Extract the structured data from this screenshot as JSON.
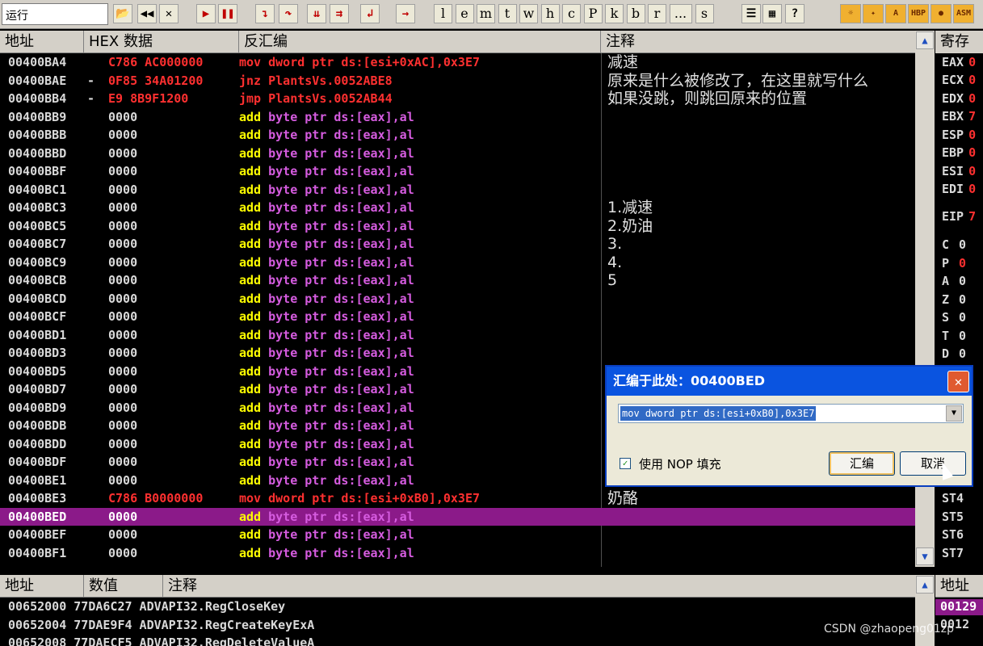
{
  "toolbar": {
    "status": "运行",
    "buttons": [
      {
        "id": "open",
        "label": "📂"
      },
      {
        "id": "restart",
        "label": "◀◀"
      },
      {
        "id": "close",
        "label": "✕"
      },
      {
        "id": "run",
        "label": "▶"
      },
      {
        "id": "pause",
        "label": "❚❚"
      },
      {
        "id": "step-into",
        "label": "↴"
      },
      {
        "id": "step-over",
        "label": "↷"
      },
      {
        "id": "trace-into",
        "label": "⇊"
      },
      {
        "id": "trace-over",
        "label": "⇉"
      },
      {
        "id": "till-return",
        "label": "↲"
      },
      {
        "id": "goto",
        "label": "→"
      }
    ],
    "letters": [
      "l",
      "e",
      "m",
      "t",
      "w",
      "h",
      "c",
      "P",
      "k",
      "b",
      "r",
      "...",
      "s"
    ],
    "right_buttons": [
      "☰",
      "▦",
      "?"
    ],
    "plugin_buttons": [
      "☼",
      "✦",
      "A",
      "HBP",
      "●",
      "ASM"
    ]
  },
  "disasm": {
    "headers": {
      "address": "地址",
      "hex": "HEX 数据",
      "disassembly": "反汇编",
      "comment": "注释"
    },
    "rows": [
      {
        "addr": "00400BA4",
        "mark": "",
        "hex": "C786 AC000000",
        "op": "mov",
        "args": "dword ptr ds:[esi+0xAC],0x3E7",
        "kind": "red",
        "cmt": "减速"
      },
      {
        "addr": "00400BAE",
        "mark": "-",
        "hex": "0F85 34A01200",
        "op": "jnz",
        "args": "PlantsVs.0052ABE8",
        "kind": "red",
        "cmt": "原来是什么被修改了，在这里就写什么"
      },
      {
        "addr": "00400BB4",
        "mark": "-",
        "hex": "E9 8B9F1200",
        "op": "jmp",
        "args": "PlantsVs.0052AB44",
        "kind": "red",
        "cmt": "如果没跳，则跳回原来的位置"
      },
      {
        "addr": "00400BB9",
        "mark": "",
        "hex": "0000",
        "op": "add",
        "args": "byte ptr ds:[eax],al",
        "kind": "add",
        "cmt": ""
      },
      {
        "addr": "00400BBB",
        "mark": "",
        "hex": "0000",
        "op": "add",
        "args": "byte ptr ds:[eax],al",
        "kind": "add",
        "cmt": ""
      },
      {
        "addr": "00400BBD",
        "mark": "",
        "hex": "0000",
        "op": "add",
        "args": "byte ptr ds:[eax],al",
        "kind": "add",
        "cmt": ""
      },
      {
        "addr": "00400BBF",
        "mark": "",
        "hex": "0000",
        "op": "add",
        "args": "byte ptr ds:[eax],al",
        "kind": "add",
        "cmt": ""
      },
      {
        "addr": "00400BC1",
        "mark": "",
        "hex": "0000",
        "op": "add",
        "args": "byte ptr ds:[eax],al",
        "kind": "add",
        "cmt": ""
      },
      {
        "addr": "00400BC3",
        "mark": "",
        "hex": "0000",
        "op": "add",
        "args": "byte ptr ds:[eax],al",
        "kind": "add",
        "cmt": "1.减速"
      },
      {
        "addr": "00400BC5",
        "mark": "",
        "hex": "0000",
        "op": "add",
        "args": "byte ptr ds:[eax],al",
        "kind": "add",
        "cmt": "2.奶油"
      },
      {
        "addr": "00400BC7",
        "mark": "",
        "hex": "0000",
        "op": "add",
        "args": "byte ptr ds:[eax],al",
        "kind": "add",
        "cmt": "3."
      },
      {
        "addr": "00400BC9",
        "mark": "",
        "hex": "0000",
        "op": "add",
        "args": "byte ptr ds:[eax],al",
        "kind": "add",
        "cmt": "4."
      },
      {
        "addr": "00400BCB",
        "mark": "",
        "hex": "0000",
        "op": "add",
        "args": "byte ptr ds:[eax],al",
        "kind": "add",
        "cmt": "5"
      },
      {
        "addr": "00400BCD",
        "mark": "",
        "hex": "0000",
        "op": "add",
        "args": "byte ptr ds:[eax],al",
        "kind": "add",
        "cmt": ""
      },
      {
        "addr": "00400BCF",
        "mark": "",
        "hex": "0000",
        "op": "add",
        "args": "byte ptr ds:[eax],al",
        "kind": "add",
        "cmt": ""
      },
      {
        "addr": "00400BD1",
        "mark": "",
        "hex": "0000",
        "op": "add",
        "args": "byte ptr ds:[eax],al",
        "kind": "add",
        "cmt": ""
      },
      {
        "addr": "00400BD3",
        "mark": "",
        "hex": "0000",
        "op": "add",
        "args": "byte ptr ds:[eax],al",
        "kind": "add",
        "cmt": ""
      },
      {
        "addr": "00400BD5",
        "mark": "",
        "hex": "0000",
        "op": "add",
        "args": "byte ptr ds:[eax],al",
        "kind": "add",
        "cmt": ""
      },
      {
        "addr": "00400BD7",
        "mark": "",
        "hex": "0000",
        "op": "add",
        "args": "byte ptr ds:[eax],al",
        "kind": "add",
        "cmt": ""
      },
      {
        "addr": "00400BD9",
        "mark": "",
        "hex": "0000",
        "op": "add",
        "args": "byte ptr ds:[eax],al",
        "kind": "add",
        "cmt": ""
      },
      {
        "addr": "00400BDB",
        "mark": "",
        "hex": "0000",
        "op": "add",
        "args": "byte ptr ds:[eax],al",
        "kind": "add",
        "cmt": ""
      },
      {
        "addr": "00400BDD",
        "mark": "",
        "hex": "0000",
        "op": "add",
        "args": "byte ptr ds:[eax],al",
        "kind": "add",
        "cmt": ""
      },
      {
        "addr": "00400BDF",
        "mark": "",
        "hex": "0000",
        "op": "add",
        "args": "byte ptr ds:[eax],al",
        "kind": "add",
        "cmt": ""
      },
      {
        "addr": "00400BE1",
        "mark": "",
        "hex": "0000",
        "op": "add",
        "args": "byte ptr ds:[eax],al",
        "kind": "add",
        "cmt": ""
      },
      {
        "addr": "00400BE3",
        "mark": "",
        "hex": "C786 B0000000",
        "op": "mov",
        "args": "dword ptr ds:[esi+0xB0],0x3E7",
        "kind": "red",
        "cmt": "奶酪"
      },
      {
        "addr": "00400BED",
        "mark": "",
        "hex": "0000",
        "op": "add",
        "args": "byte ptr ds:[eax],al",
        "kind": "add",
        "cmt": "",
        "selected": true
      },
      {
        "addr": "00400BEF",
        "mark": "",
        "hex": "0000",
        "op": "add",
        "args": "byte ptr ds:[eax],al",
        "kind": "add",
        "cmt": ""
      },
      {
        "addr": "00400BF1",
        "mark": "",
        "hex": "0000",
        "op": "add",
        "args": "byte ptr ds:[eax],al",
        "kind": "add",
        "cmt": ""
      }
    ]
  },
  "registers": {
    "header": "寄存器",
    "items": [
      {
        "name": "EAX",
        "val": "0"
      },
      {
        "name": "ECX",
        "val": "0"
      },
      {
        "name": "EDX",
        "val": "0"
      },
      {
        "name": "EBX",
        "val": "7"
      },
      {
        "name": "ESP",
        "val": "0"
      },
      {
        "name": "EBP",
        "val": "0"
      },
      {
        "name": "ESI",
        "val": "0"
      },
      {
        "name": "EDI",
        "val": "0"
      },
      {
        "name": "EIP",
        "val": "7"
      }
    ],
    "flags": [
      {
        "name": "C",
        "val": "0",
        "red": false
      },
      {
        "name": "P",
        "val": "0",
        "red": true
      },
      {
        "name": "A",
        "val": "0",
        "red": false
      },
      {
        "name": "Z",
        "val": "0",
        "red": false
      },
      {
        "name": "S",
        "val": "0",
        "red": false
      },
      {
        "name": "T",
        "val": "0",
        "red": false
      },
      {
        "name": "D",
        "val": "0",
        "red": false
      }
    ],
    "fpu": [
      "ST4",
      "ST5",
      "ST6",
      "ST7"
    ]
  },
  "dump": {
    "headers": {
      "address": "地址",
      "value": "数值",
      "comment": "注释"
    },
    "rows": [
      "00652000 77DA6C27 ADVAPI32.RegCloseKey",
      "00652004 77DAE9F4 ADVAPI32.RegCreateKeyExA",
      "00652008 77DAECF5 ADVAPI32.RegDeleteValueA"
    ]
  },
  "stack": {
    "header": "地址",
    "rows": [
      "00129",
      "0012"
    ]
  },
  "dialog": {
    "title": "汇编于此处：00400BED",
    "close": "✕",
    "input_value": "mov dword ptr ds:[esi+0xB0],0x3E7",
    "dropdown_arrow": "▼",
    "checkbox_checked": true,
    "checkbox_mark": "✓",
    "checkbox_label": "使用 NOP 填充",
    "ok_label": "汇编",
    "cancel_label": "取消"
  },
  "watermark": "CSDN @zhaopeng01zp",
  "scroll": {
    "up": "▲",
    "down": "▼"
  }
}
